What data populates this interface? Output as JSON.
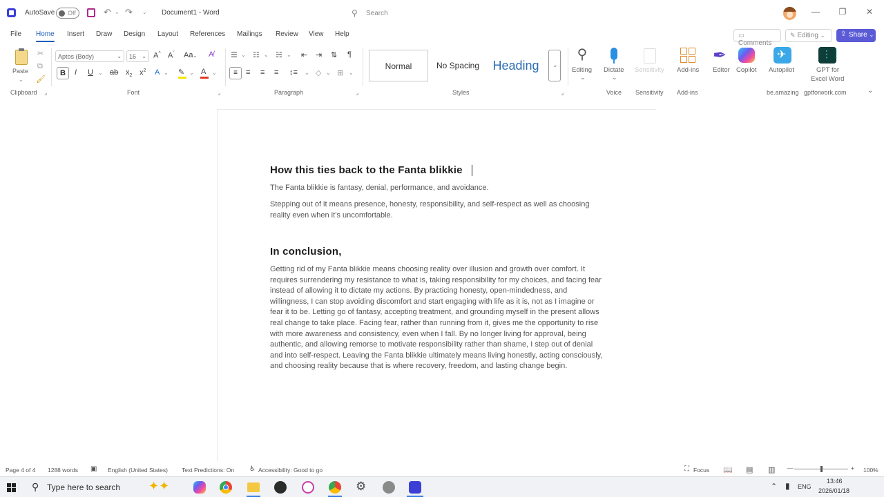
{
  "titlebar": {
    "autosave_label": "AutoSave",
    "autosave_state": "Off",
    "doc_title": "Document1 - Word",
    "search_placeholder": "Search",
    "minimize": "—",
    "restore": "❐",
    "close": "✕"
  },
  "tabs": [
    "File",
    "Home",
    "Insert",
    "Draw",
    "Design",
    "Layout",
    "References",
    "Mailings",
    "Review",
    "View",
    "Help"
  ],
  "active_tab": "Home",
  "top_buttons": {
    "comments": "Comments",
    "editing": "Editing",
    "share": "Share"
  },
  "ribbon": {
    "clipboard": {
      "paste": "Paste",
      "group": "Clipboard"
    },
    "font": {
      "name": "Aptos (Body)",
      "size": "16",
      "group": "Font"
    },
    "paragraph": {
      "group": "Paragraph"
    },
    "styles": {
      "items": [
        "Normal",
        "No Spacing",
        "Heading"
      ],
      "group": "Styles"
    },
    "editing_btn": "Editing",
    "dictate_btn": "Dictate",
    "sensitivity_btn": "Sensitivity",
    "addins_btn": "Add-ins",
    "editor_btn": "Editor",
    "copilot_btn": "Copilot",
    "autopilot_btn": "Autopilot",
    "gpt_btn_line1": "GPT for",
    "gpt_btn_line2": "Excel Word",
    "groups": {
      "voice": "Voice",
      "sensitivity": "Sensitivity",
      "addins": "Add-ins",
      "beamazing": "be.amazing",
      "gptforwork": "gptforwork.com"
    }
  },
  "document": {
    "heading1": "How this ties back to the Fanta blikkie",
    "para1": "The Fanta blikkie is fantasy, denial, performance, and avoidance.",
    "para2": "Stepping out of it means presence, honesty, responsibility, and self-respect as well as choosing reality even when it’s uncomfortable.",
    "heading2": "In conclusion,",
    "para3": "Getting rid of my Fanta blikkie means choosing reality over illusion and growth over comfort. It requires surrendering my resistance to what is, taking responsibility for my choices, and facing fear instead of allowing it to dictate my actions. By practicing honesty, open-mindedness, and willingness, I can stop avoiding discomfort and start engaging with life as it is, not as I imagine or fear it to be. Letting go of fantasy, accepting treatment, and grounding myself in the present allows real change to take place. Facing fear, rather than running from it, gives me the opportunity to rise with more awareness and consistency, even when I fall. By no longer living for approval, being authentic, and allowing remorse to motivate responsibility rather than shame, I step out of denial and into self-respect. Leaving the Fanta blikkie ultimately means living honestly, acting consciously, and choosing reality because that is where recovery, freedom, and lasting change begin."
  },
  "status": {
    "page": "Page 4 of 4",
    "words": "1288 words",
    "language": "English (United States)",
    "predictions": "Text Predictions: On",
    "accessibility": "Accessibility: Good to go",
    "focus": "Focus",
    "zoom": "100%"
  },
  "taskbar": {
    "search_placeholder": "Type here to search",
    "lang": "ENG",
    "time": "13:46",
    "date": "2026/01/18"
  },
  "colors": {
    "accent": "#1f5fb5",
    "share": "#5b5bd6",
    "heading_style": "#2b6cb0"
  }
}
